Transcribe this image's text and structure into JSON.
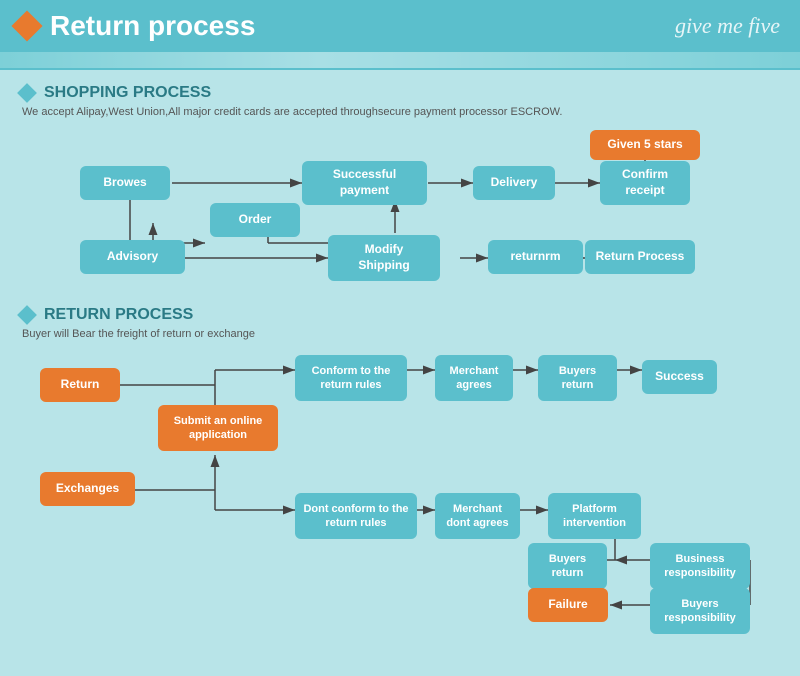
{
  "header": {
    "title": "Return process",
    "brand": "give me five",
    "diamond_color": "#e87a2e"
  },
  "shopping_section": {
    "title": "SHOPPING PROCESS",
    "subtitle": "We accept Alipay,West Union,All major credit cards are accepted throughsecure payment processor ESCROW.",
    "nodes": {
      "browes": "Browes",
      "order": "Order",
      "advisory": "Advisory",
      "modify_shipping": "Modify\nShipping",
      "successful_payment": "Successful\npayment",
      "delivery": "Delivery",
      "confirm_receipt": "Confirm\nreceipt",
      "given5stars": "Given 5 stars",
      "returnrm": "returnrm",
      "return_process": "Return Process"
    }
  },
  "return_section": {
    "title": "RETURN PROCESS",
    "subtitle": "Buyer will Bear the freight of return or exchange",
    "nodes": {
      "return": "Return",
      "exchanges": "Exchanges",
      "submit_online": "Submit an online\napplication",
      "conform_rules": "Conform to the\nreturn rules",
      "dont_conform": "Dont conform to the\nreturn rules",
      "merchant_agrees": "Merchant\nagrees",
      "merchant_dont": "Merchant\ndont agrees",
      "buyers_return1": "Buyers\nreturn",
      "buyers_return2": "Buyers\nreturn",
      "success": "Success",
      "platform_intervention": "Platform\nintervention",
      "business_responsibility": "Business\nresponsibility",
      "buyers_responsibility": "Buyers\nresponsibility",
      "failure": "Failure"
    }
  }
}
